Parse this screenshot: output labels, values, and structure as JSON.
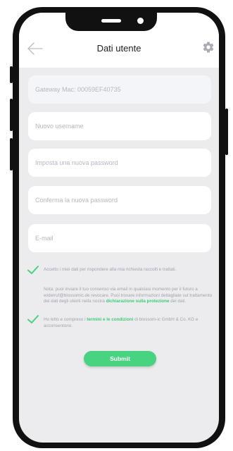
{
  "header": {
    "title": "Dati utente",
    "back_icon": "arrow-left-icon",
    "settings_icon": "gear-icon"
  },
  "form": {
    "gateway_mac": "Gateway Mac: 00059EF40735",
    "username_placeholder": "Nuovo username",
    "password_placeholder": "Imposta una nuova password",
    "confirm_password_placeholder": "Conferma la nuova password",
    "email_placeholder": "E-mail"
  },
  "consent1": {
    "text": "Accetto i miei dati per rispondere alla mia richiesta raccolti e trattati.",
    "note_before": "Nota: puoi inviare il tuo consenso via email in qualsiasi momento per il futuro a widerruf@blossomic.de revocare. Puoi trovare informazioni dettagliate sul trattamento dei dati degli utenti nella nostra ",
    "note_link": "dichiarazione sulla protezione",
    "note_after": " dei dati.",
    "checked": true
  },
  "consent2": {
    "text_before": "Ho letto e compreso i ",
    "link": "termini e le condizioni",
    "text_after": " di blossom-ic GmbH & Co. KG e acconsentono.",
    "checked": true
  },
  "submit_label": "Submit",
  "colors": {
    "accent": "#47d37f",
    "screen_bg": "#ececef",
    "text_muted": "#a0a4ab"
  }
}
